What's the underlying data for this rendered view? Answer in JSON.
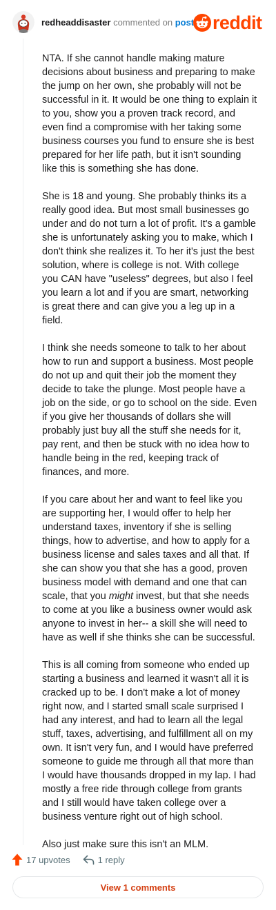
{
  "comment": {
    "author": "redheaddisaster",
    "action_text": "commented on",
    "post_link": "post",
    "paragraphs": [
      "NTA. If she cannot handle making mature decisions about business and preparing to make the jump on her own, she probably will not be successful in it. It would be one thing to explain it to you, show you a proven track record, and even find a compromise with her taking some business courses you fund to ensure she is best prepared for her life path, but it isn't sounding like this is something she has done.",
      "She is 18 and young. She probably thinks its a really good idea. But most small businesses go under and do not turn a lot of profit. It's a gamble she is unfortunately asking you to make, which I don't think she realizes it. To her it's just the best solution, where is college is not. With college you CAN have \"useless\" degrees, but also I feel you learn a lot and if you are smart, networking is great there and can give you a leg up in a field.",
      "I think she needs someone to talk to her about how to run and support a business. Most people do not up and quit their job the moment they decide to take the plunge. Most people have a job on the side, or go to school on the side. Even if you give her thousands of dollars she will probably just buy all the stuff she needs for it, pay rent, and then be stuck with no idea how to handle being in the red, keeping track of finances, and more."
    ],
    "paragraph4_before": "If you care about her and want to feel like you are supporting her, I would offer to help her understand taxes, inventory if she is selling things, how to advertise, and how to apply for a business license and sales taxes and all that. If she can show you that she has a good, proven business model with demand and one that can scale, that you ",
    "paragraph4_emphasis": "might",
    "paragraph4_after": " invest, but that she needs to come at you like a business owner would ask anyone to invest in her-- a skill she will need to have as well if she thinks she can be successful.",
    "paragraph5": "This is all coming from someone who ended up starting a business and learned it wasn't all it is cracked up to be. I don't make a lot of money right now, and I started small scale surprised I had any interest, and had to learn all the legal stuff, taxes, advertising, and fulfillment all on my own. It isn't very fun, and I would have preferred someone to guide me through all that more than I would have thousands dropped in my lap. I had mostly a free ride through college from grants and I still would have taken college over a business venture right out of high school.",
    "paragraph6": "Also just make sure this isn't an MLM."
  },
  "brand": {
    "logo_text": "reddit",
    "color": "#ff4500",
    "logo_icon": "reddit-snoo-icon"
  },
  "actions": {
    "upvotes": "17 upvotes",
    "upvote_icon": "upvote-arrow-icon",
    "replies": "1 reply",
    "reply_icon": "reply-arrow-icon"
  },
  "footer": {
    "view_comments": "View 1 comments",
    "accent_color": "#d44013"
  }
}
